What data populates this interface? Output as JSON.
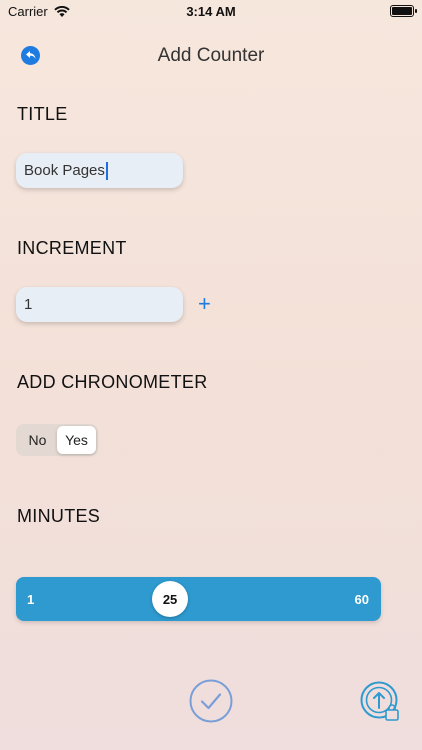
{
  "status": {
    "carrier": "Carrier",
    "time": "3:14 AM"
  },
  "nav": {
    "title": "Add Counter"
  },
  "form": {
    "title_label": "TITLE",
    "title_value": "Book Pages",
    "increment_label": "INCREMENT",
    "increment_value": "1",
    "increment_plus": "+",
    "chrono_label": "ADD CHRONOMETER",
    "chrono_options": [
      "No",
      "Yes"
    ],
    "chrono_selected": "Yes",
    "minutes_label": "MINUTES"
  },
  "slider": {
    "min": 1,
    "max": 60,
    "value": 25
  },
  "colors": {
    "accent": "#1e7be0",
    "slider": "#2e9acf",
    "confirm": "#7a9ed8",
    "share": "#2e9acf"
  },
  "icons": {
    "back": "back-arrow-icon",
    "confirm": "checkmark-circle-icon",
    "share": "upload-bag-icon"
  }
}
